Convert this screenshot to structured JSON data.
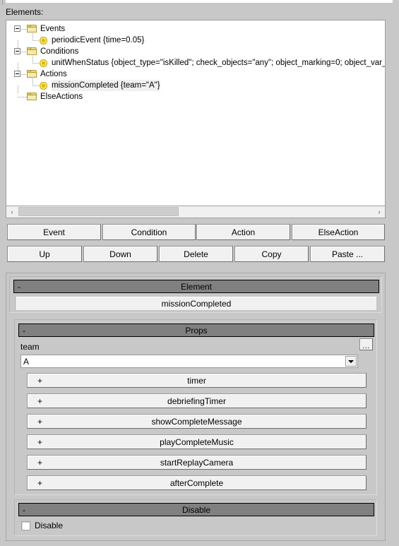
{
  "panel": {
    "elements_label": "Elements:"
  },
  "tree": {
    "nodes": [
      {
        "label": "Events",
        "icon": "folder-icon",
        "type": "folder",
        "depth": 0,
        "expanded": true,
        "selected": false
      },
      {
        "label": "periodicEvent {time=0.05}",
        "icon": "bullet-icon",
        "type": "leaf",
        "depth": 1,
        "expanded": false,
        "selected": false
      },
      {
        "label": "Conditions",
        "icon": "folder-icon",
        "type": "folder",
        "depth": 0,
        "expanded": true,
        "selected": false
      },
      {
        "label": "unitWhenStatus {object_type=\"isKilled\"; check_objects=\"any\"; object_marking=0; object_var_na",
        "icon": "bullet-icon",
        "type": "leaf",
        "depth": 1,
        "expanded": false,
        "selected": false
      },
      {
        "label": "Actions",
        "icon": "folder-icon",
        "type": "folder",
        "depth": 0,
        "expanded": true,
        "selected": false
      },
      {
        "label": "missionCompleted {team=\"A\"}",
        "icon": "bullet-icon",
        "type": "leaf",
        "depth": 1,
        "expanded": false,
        "selected": true
      },
      {
        "label": "ElseActions",
        "icon": "folder-icon",
        "type": "folder",
        "depth": 0,
        "expanded": false,
        "selected": false
      }
    ],
    "scrollbar": {
      "left_arrow": "‹",
      "right_arrow": "›"
    }
  },
  "toolbar": {
    "row1": [
      {
        "label": "Event",
        "name": "event-button"
      },
      {
        "label": "Condition",
        "name": "condition-button"
      },
      {
        "label": "Action",
        "name": "action-button"
      },
      {
        "label": "ElseAction",
        "name": "elseaction-button"
      }
    ],
    "row2": [
      {
        "label": "Up",
        "name": "up-button"
      },
      {
        "label": "Down",
        "name": "down-button"
      },
      {
        "label": "Delete",
        "name": "delete-button"
      },
      {
        "label": "Copy",
        "name": "copy-button"
      },
      {
        "label": "Paste ...",
        "name": "paste-button"
      }
    ]
  },
  "element_section": {
    "header_sign": "-",
    "header_title": "Element",
    "name_value": "missionCompleted"
  },
  "props_section": {
    "header_sign": "-",
    "header_title": "Props",
    "team": {
      "label": "team",
      "value": "A",
      "browse_label": "...",
      "dropdown_icon": "chevron-down-icon"
    },
    "collapsed": [
      {
        "sign": "+",
        "label": "timer"
      },
      {
        "sign": "+",
        "label": "debriefingTimer"
      },
      {
        "sign": "+",
        "label": "showCompleteMessage"
      },
      {
        "sign": "+",
        "label": "playCompleteMusic"
      },
      {
        "sign": "+",
        "label": "startReplayCamera"
      },
      {
        "sign": "+",
        "label": "afterComplete"
      }
    ]
  },
  "disable_section": {
    "header_sign": "-",
    "header_title": "Disable",
    "checkbox_label": "Disable",
    "checked": false
  },
  "colors": {
    "window_bg": "#c8c8c8",
    "tree_bg": "#ffffff",
    "section_header_bg": "#808080",
    "button_face": "#f1f1f1",
    "folder_icon": "#e8dc8c",
    "bullet_icon": "#f7e96b"
  }
}
